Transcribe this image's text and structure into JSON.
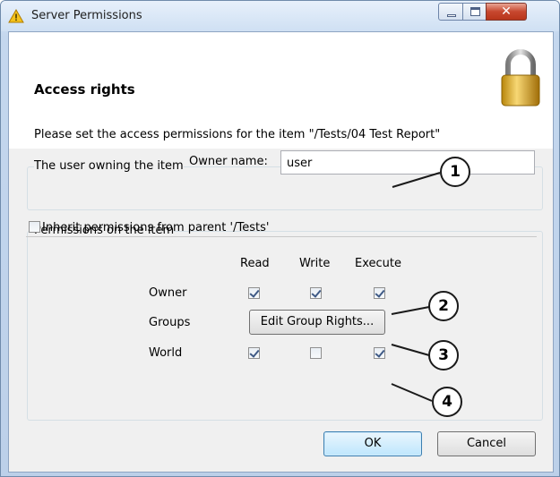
{
  "window": {
    "title": "Server Permissions",
    "icon": "warning-triangle-icon"
  },
  "header": {
    "title": "Access rights",
    "description": "Please set the access permissions for the item  \"/Tests/04 Test Report\"",
    "icon": "padlock-icon"
  },
  "owner_group": {
    "legend": "The user owning the item",
    "owner_label": "Owner name:",
    "owner_value": "user"
  },
  "permissions_group": {
    "legend": "Permissions on the item",
    "inherit_label": "Inherit permissions from parent '/Tests'",
    "inherit_checked": false,
    "columns": [
      "Read",
      "Write",
      "Execute"
    ],
    "rows": [
      {
        "label": "Owner",
        "read": true,
        "write": true,
        "execute": true
      },
      {
        "label": "Groups",
        "button": "Edit Group Rights..."
      },
      {
        "label": "World",
        "read": true,
        "write": false,
        "execute": true
      }
    ]
  },
  "buttons": {
    "ok": "OK",
    "cancel": "Cancel"
  },
  "callouts": [
    "1",
    "2",
    "3",
    "4"
  ],
  "colors": {
    "title_bar": "#cfe0f3",
    "client_bg": "#f0f0f0",
    "close_button": "#c7472e",
    "primary_button": "#bee6fd"
  }
}
